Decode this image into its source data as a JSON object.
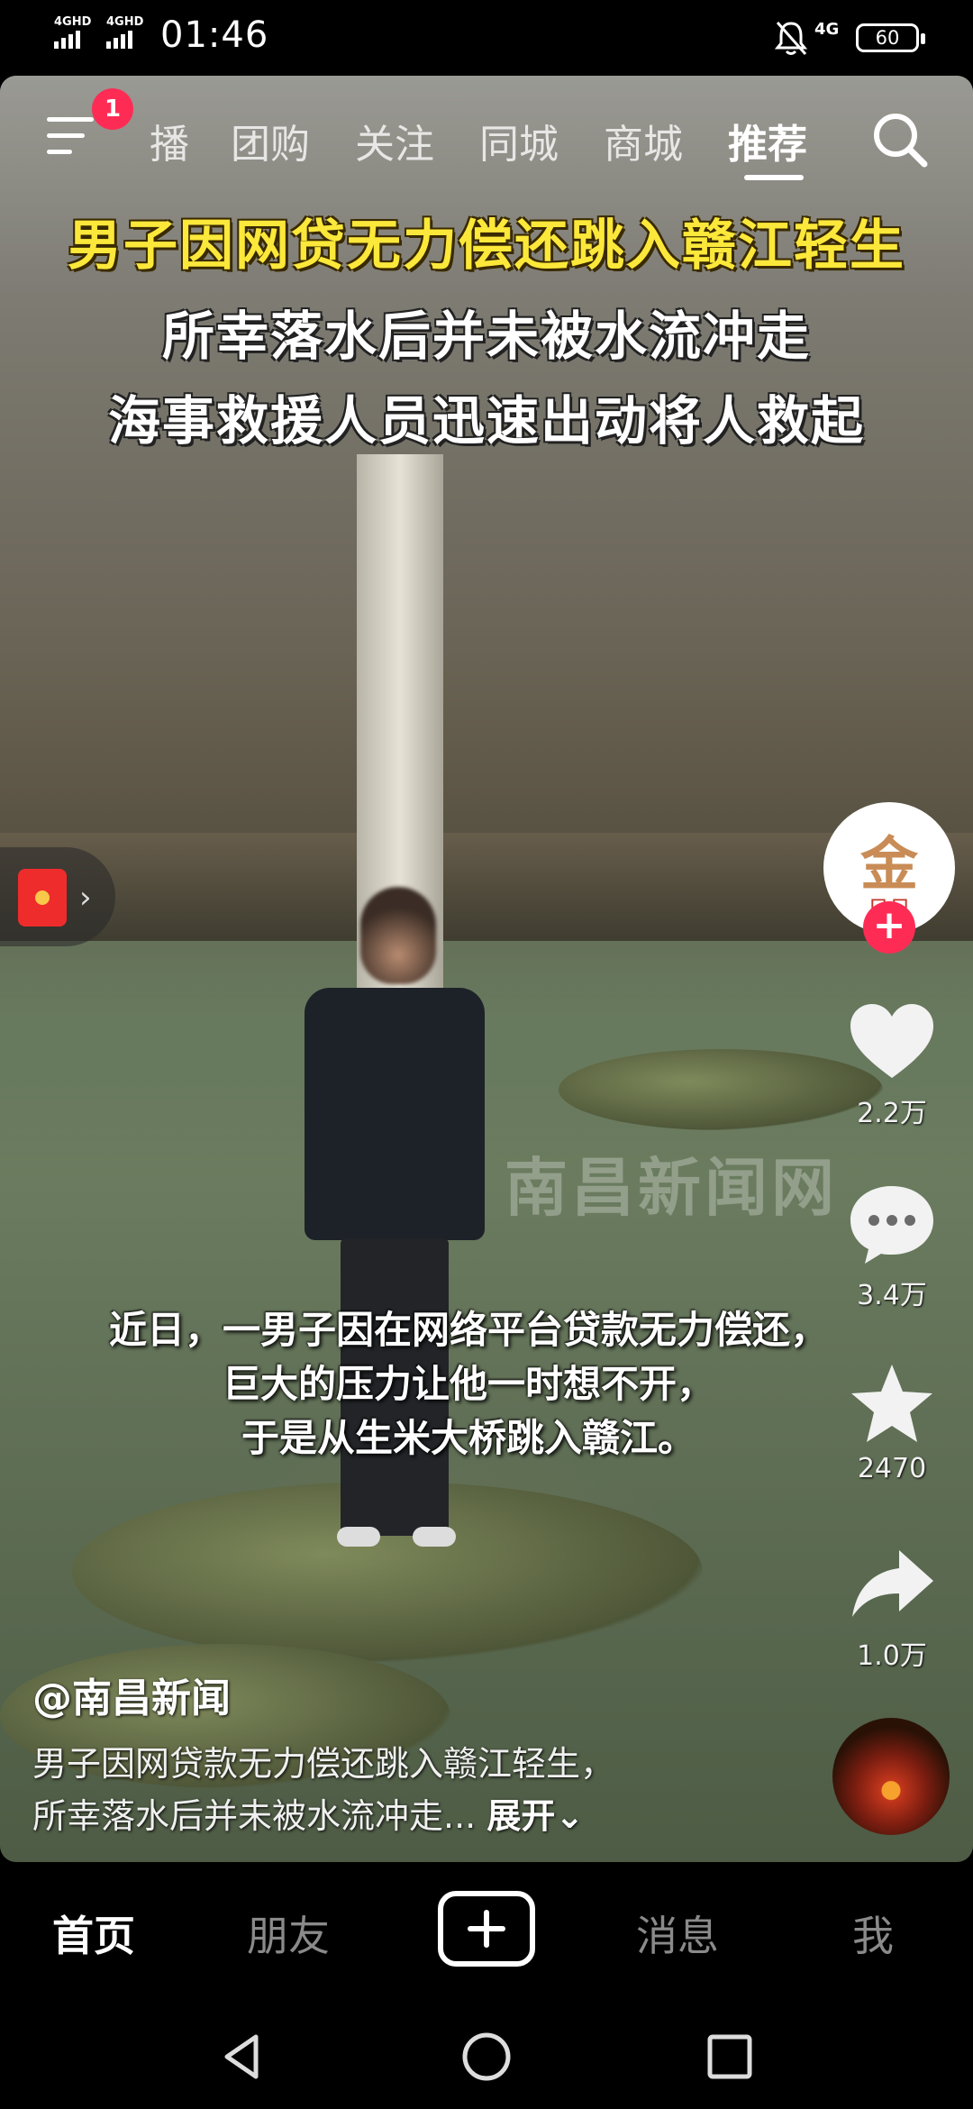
{
  "status_bar": {
    "signal1": "4GHD",
    "signal2": "4GHD",
    "time": "01:46",
    "network": "4G",
    "battery": "60"
  },
  "top_tabs": {
    "notification_count": "1",
    "tabs": [
      "播",
      "团购",
      "关注",
      "同城",
      "商城",
      "推荐"
    ],
    "active_tab": "推荐"
  },
  "video": {
    "headline_yellow": "男子因网贷无力偿还跳入赣江轻生",
    "headline_line2": "所幸落水后并未被水流冲走",
    "headline_line3": "海事救援人员迅速出动将人救起",
    "watermark": "南昌新闻网",
    "subtitles": [
      "近日，一男子因在网络平台贷款无力偿还，",
      "巨大的压力让他一时想不开，",
      "于是从生米大桥跳入赣江。"
    ]
  },
  "actions": {
    "like_count": "2.2万",
    "comment_count": "3.4万",
    "favorite_count": "2470",
    "share_count": "1.0万"
  },
  "caption": {
    "author": "@南昌新闻",
    "line1": "男子因网贷款无力偿还跳入赣江轻生，",
    "line2": "所幸落水后并未被水流冲走...",
    "expand": "展开"
  },
  "bottom_nav": {
    "home": "首页",
    "friends": "朋友",
    "messages": "消息",
    "me": "我"
  },
  "colors": {
    "accent": "#fe2c55",
    "headline_yellow": "#fbe83a"
  }
}
